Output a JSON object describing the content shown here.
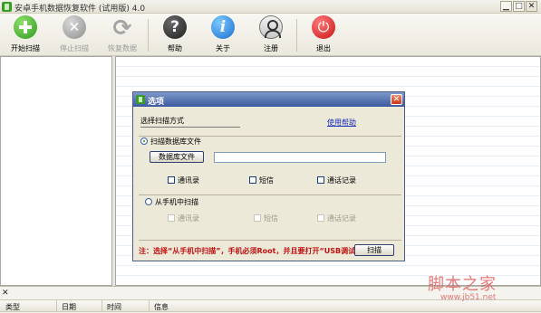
{
  "window": {
    "title": "安卓手机数据恢复软件 (试用版) 4.0",
    "minimize_glyph": "▁",
    "maximize_glyph": "□",
    "close_glyph": "✕"
  },
  "toolbar": {
    "start_scan": "开始扫描",
    "stop_scan": "停止扫描",
    "recover_data": "恢复数据",
    "help": "帮助",
    "about": "关于",
    "register": "注册",
    "exit": "退出"
  },
  "dialog": {
    "title": "选项",
    "close_glyph": "✕",
    "section_title": "选择扫描方式",
    "help_link": "使用帮助",
    "scan_db": {
      "label": "扫描数据库文件",
      "checked": true,
      "db_button": "数据库文件",
      "path_value": "",
      "checkboxes": [
        "通讯录",
        "短信",
        "通话记录"
      ]
    },
    "scan_phone": {
      "label": "从手机中扫描",
      "checked": false,
      "checkboxes": [
        "通讯录",
        "短信",
        "通话记录"
      ]
    },
    "note": "注：选择“从手机中扫描”，手机必须Root，并且要打开“USB调试”",
    "scan_button": "扫描"
  },
  "log_panel": {
    "close_glyph": "✕",
    "columns": [
      "类型",
      "日期",
      "时间",
      "信息"
    ]
  },
  "watermark": {
    "text": "脚本之家",
    "url": "www.jb51.net"
  },
  "colors": {
    "accent": "#3b5aa0",
    "note_red": "#c01010",
    "link_blue": "#1a2fb8"
  }
}
